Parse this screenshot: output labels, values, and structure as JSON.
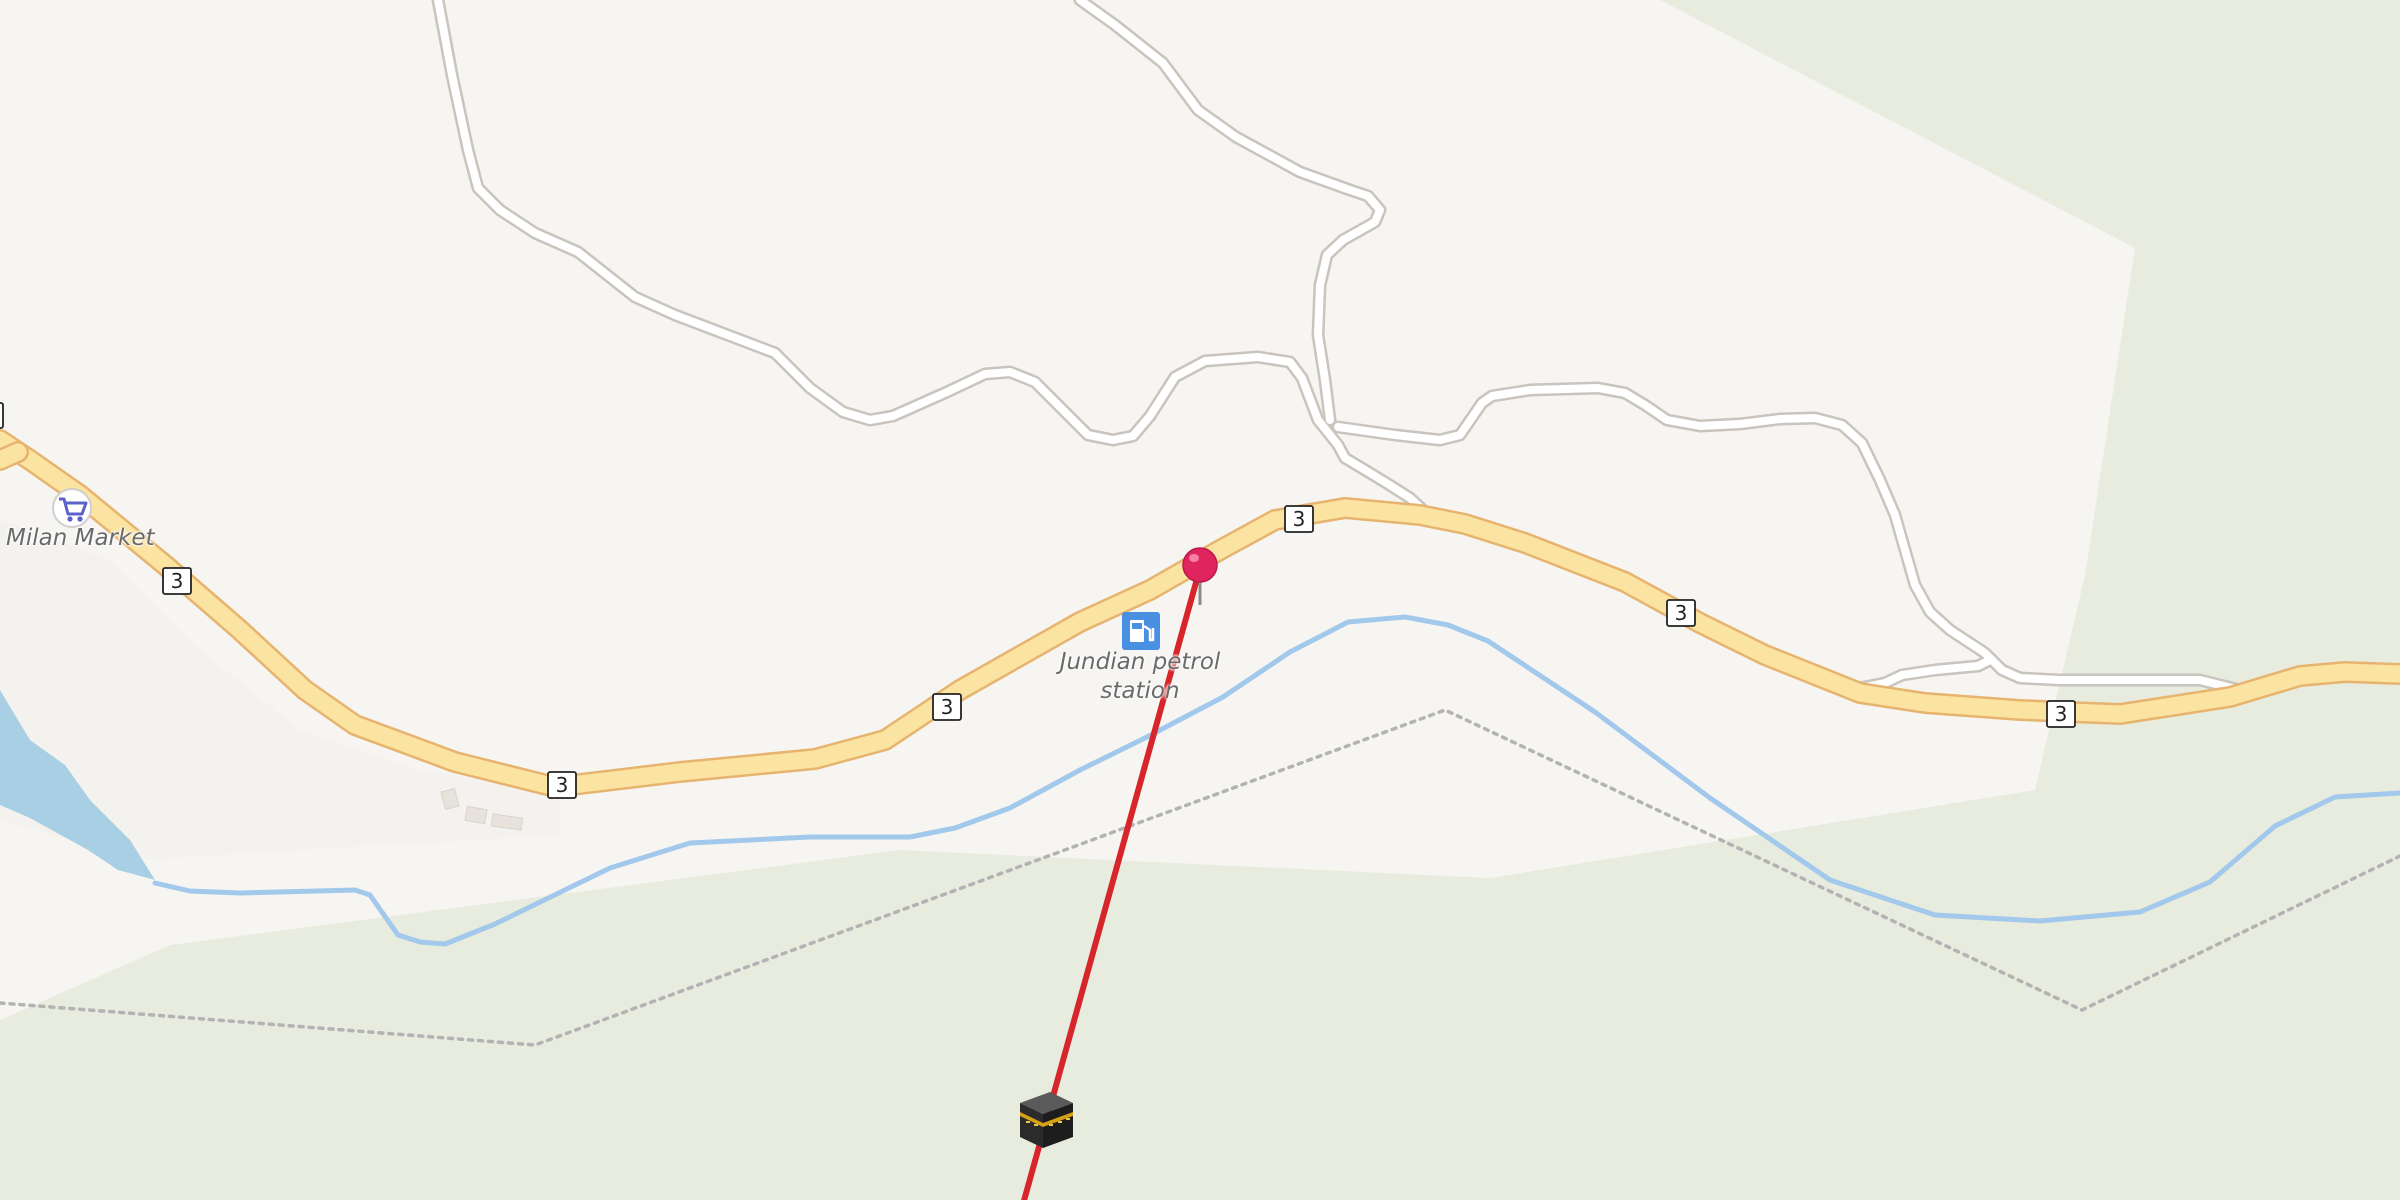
{
  "map": {
    "pois": {
      "milan_market": {
        "name": "Milan Market",
        "icon": "shopping-cart-icon"
      },
      "jundian_station": {
        "name": "Jundian petrol station",
        "icon": "fuel-pump-icon"
      }
    },
    "road_shield_label": "3",
    "marker": {
      "icon": "red-pin-icon",
      "color": "#e0245e"
    },
    "destination_icon": "kaaba-icon",
    "direction_line_color": "#d7262b",
    "colors": {
      "land": "#f7f5f2",
      "forest": "#e8ecdf",
      "water": "#a9cfe4",
      "river": "#a2c8ec",
      "primary_road_fill": "#fbe3a1",
      "primary_road_casing": "#e7b46f",
      "minor_road": "#ffffff",
      "boundary": "#b8b8b8"
    }
  }
}
